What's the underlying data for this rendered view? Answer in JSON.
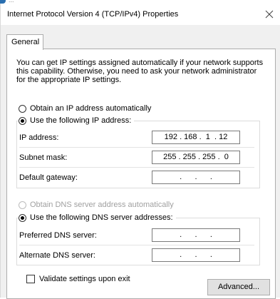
{
  "window": {
    "title": "Internet Protocol Version 4 (TCP/IPv4) Properties",
    "close_icon": "close-icon",
    "partial_text_above": "..."
  },
  "tabs": [
    {
      "label": "General",
      "active": true
    }
  ],
  "description": "You can get IP settings assigned automatically if your network supports\nthis capability. Otherwise, you need to ask your network administrator\nfor the appropriate IP settings.",
  "ip": {
    "auto_label": "Obtain an IP address automatically",
    "manual_label": "Use the following IP address:",
    "selected": "manual",
    "fields": [
      {
        "label": "IP address:",
        "value": "192 . 168 .  1  . 12"
      },
      {
        "label": "Subnet mask:",
        "value": "255 . 255 . 255 .  0"
      },
      {
        "label": "Default gateway:",
        "value": " .      .      . "
      }
    ]
  },
  "dns": {
    "auto_label": "Obtain DNS server address automatically",
    "auto_disabled": true,
    "manual_label": "Use the following DNS server addresses:",
    "selected": "manual",
    "fields": [
      {
        "label": "Preferred DNS server:",
        "value": " .      .      . "
      },
      {
        "label": "Alternate DNS server:",
        "value": " .      .      . "
      }
    ]
  },
  "validate": {
    "label": "Validate settings upon exit",
    "checked": false
  },
  "advanced_button": "Advanced..."
}
